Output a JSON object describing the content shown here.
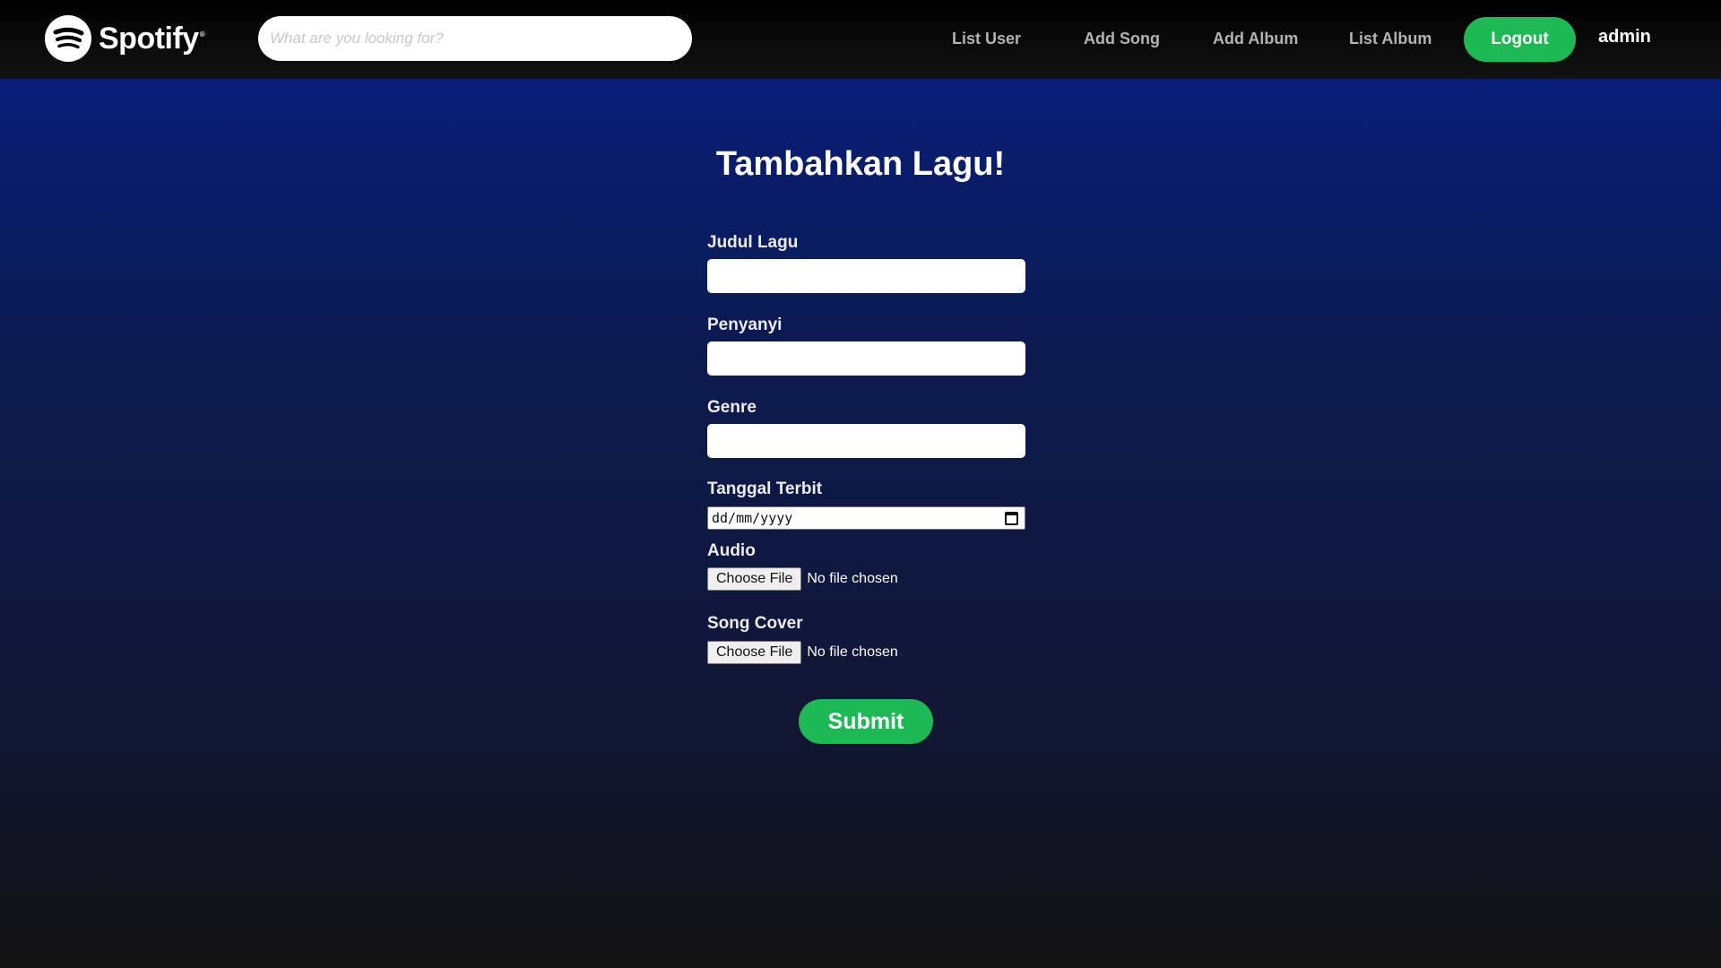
{
  "app": {
    "brand": "Spotify",
    "brand_mark": "®",
    "accent_color": "#1db954"
  },
  "header": {
    "search_placeholder": "What are you looking for?",
    "search_value": "",
    "nav": [
      {
        "label": "List User"
      },
      {
        "label": "Add Song"
      },
      {
        "label": "Add Album"
      },
      {
        "label": "List Album"
      }
    ],
    "logout_label": "Logout",
    "username": "admin"
  },
  "form": {
    "title": "Tambahkan Lagu!",
    "fields": {
      "judul": {
        "label": "Judul Lagu",
        "value": ""
      },
      "penyanyi": {
        "label": "Penyanyi",
        "value": ""
      },
      "genre": {
        "label": "Genre",
        "value": ""
      },
      "tanggal": {
        "label": "Tanggal Terbit",
        "placeholder": "dd/mm/yyyy"
      },
      "audio": {
        "label": "Audio",
        "button_label": "Choose File",
        "status": "No file chosen"
      },
      "cover": {
        "label": "Song Cover",
        "button_label": "Choose File",
        "status": "No file chosen"
      }
    },
    "submit_label": "Submit"
  }
}
